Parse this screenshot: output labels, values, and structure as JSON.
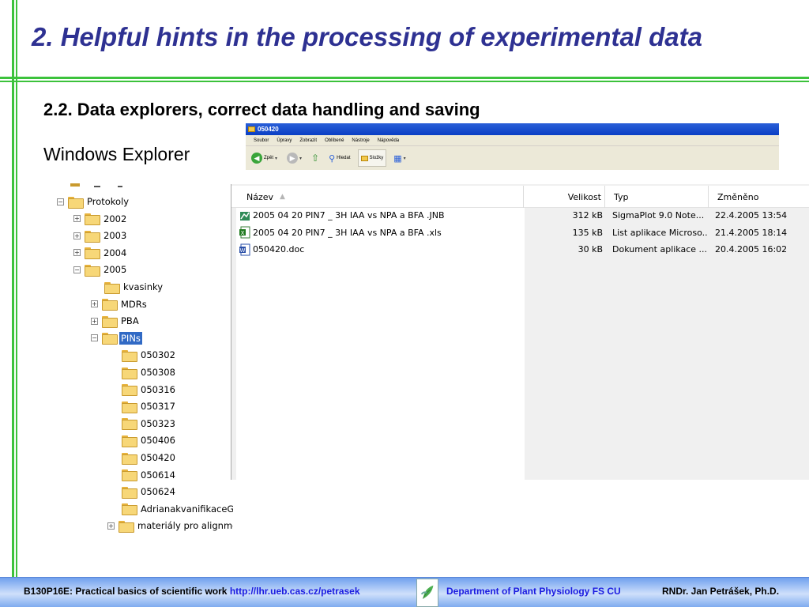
{
  "slide": {
    "title": "2. Helpful hints in the processing of experimental data",
    "subtitle": "2.2. Data explorers, correct data handling and saving",
    "explorer_label": "Windows Explorer",
    "colors": {
      "title": "#2e3192",
      "accent_green": "#3cc23c",
      "footer_link": "#1a1ae0"
    }
  },
  "window": {
    "title": "050420",
    "menu": [
      "Soubor",
      "Úpravy",
      "Zobrazit",
      "Oblíbené",
      "Nástroje",
      "Nápověda"
    ],
    "toolbar": {
      "back_label": "Zpět",
      "search_label": "Hledat",
      "folders_label": "Složky"
    }
  },
  "tree": {
    "items": [
      {
        "label": "Protokoly",
        "expander": "⊟"
      },
      {
        "label": "2002",
        "expander": "⊞"
      },
      {
        "label": "2003",
        "expander": "⊞"
      },
      {
        "label": "2004",
        "expander": "⊞"
      },
      {
        "label": "2005",
        "expander": "⊟"
      },
      {
        "label": "kvasinky",
        "expander": ""
      },
      {
        "label": "MDRs",
        "expander": "⊞"
      },
      {
        "label": "PBA",
        "expander": "⊞"
      },
      {
        "label": "PINs",
        "expander": "⊟",
        "selected": true
      },
      {
        "label": "050302",
        "expander": ""
      },
      {
        "label": "050308",
        "expander": ""
      },
      {
        "label": "050316",
        "expander": ""
      },
      {
        "label": "050317",
        "expander": ""
      },
      {
        "label": "050323",
        "expander": ""
      },
      {
        "label": "050406",
        "expander": ""
      },
      {
        "label": "050420",
        "expander": ""
      },
      {
        "label": "050614",
        "expander": ""
      },
      {
        "label": "050624",
        "expander": ""
      },
      {
        "label": "AdrianakvanifikaceGE",
        "expander": ""
      },
      {
        "label": "materiály pro alignme",
        "expander": "⊞"
      }
    ]
  },
  "list": {
    "columns": [
      "Název",
      "Velikost",
      "Typ",
      "Změněno"
    ],
    "files": [
      {
        "name": "2005 04 20  PIN7 _ 3H IAA vs NPA a BFA .JNB",
        "size": "312 kB",
        "type": "SigmaPlot 9.0 Note...",
        "modified": "22.4.2005 13:54",
        "icon": "sigmaplot-icon"
      },
      {
        "name": "2005 04 20  PIN7 _ 3H IAA vs NPA a BFA .xls",
        "size": "135 kB",
        "type": "List aplikace Microso...",
        "modified": "21.4.2005 18:14",
        "icon": "excel-icon"
      },
      {
        "name": "050420.doc",
        "size": "30 kB",
        "type": "Dokument aplikace ...",
        "modified": "20.4.2005 16:02",
        "icon": "word-icon"
      }
    ]
  },
  "footer": {
    "course": "B130P16E: Practical basics of scientific work",
    "url": "http://lhr.ueb.cas.cz/petrasek",
    "department": "Department of Plant Physiology FS CU",
    "author": "RNDr. Jan Petrášek, Ph.D."
  }
}
